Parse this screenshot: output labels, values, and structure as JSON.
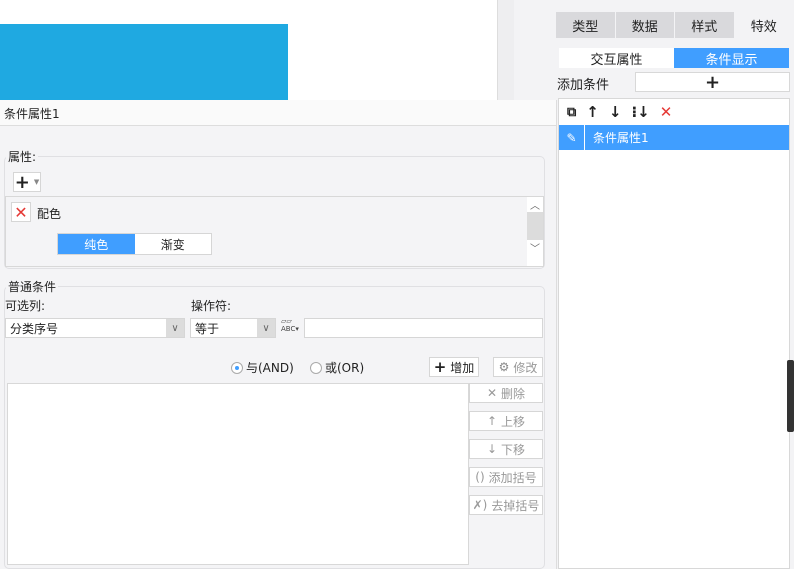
{
  "right_panel": {
    "tabs": [
      {
        "label": "类型"
      },
      {
        "label": "数据"
      },
      {
        "label": "样式"
      },
      {
        "label": "特效",
        "active": true
      }
    ],
    "subtabs": [
      {
        "label": "交互属性"
      },
      {
        "label": "条件显示",
        "active": true
      }
    ],
    "add_condition_label": "添加条件",
    "add_icon": "+",
    "list_items": [
      {
        "label": "条件属性1",
        "selected": true
      }
    ]
  },
  "dialog": {
    "title": "条件属性1",
    "attributes_label": "属性:",
    "add_attr_icon": "+",
    "attr_name": "配色",
    "color_modes": [
      {
        "label": "纯色",
        "active": true
      },
      {
        "label": "渐变"
      }
    ],
    "normal_conditions_label": "普通条件",
    "column_label": "可选列:",
    "column_value": "分类序号",
    "operator_label": "操作符:",
    "operator_value": "等于",
    "value_input": "",
    "and_label": "与(AND)",
    "or_label": "或(OR)",
    "logic_selected": "AND",
    "add_btn": "增加",
    "modify_btn": "修改",
    "delete_btn": "删除",
    "up_btn": "上移",
    "down_btn": "下移",
    "add_paren_btn": "添加括号",
    "remove_paren_btn": "去掉括号"
  },
  "colors": {
    "accent": "#409eff",
    "chart_bar": "#1fa9e1",
    "delete_red": "#e53935"
  }
}
